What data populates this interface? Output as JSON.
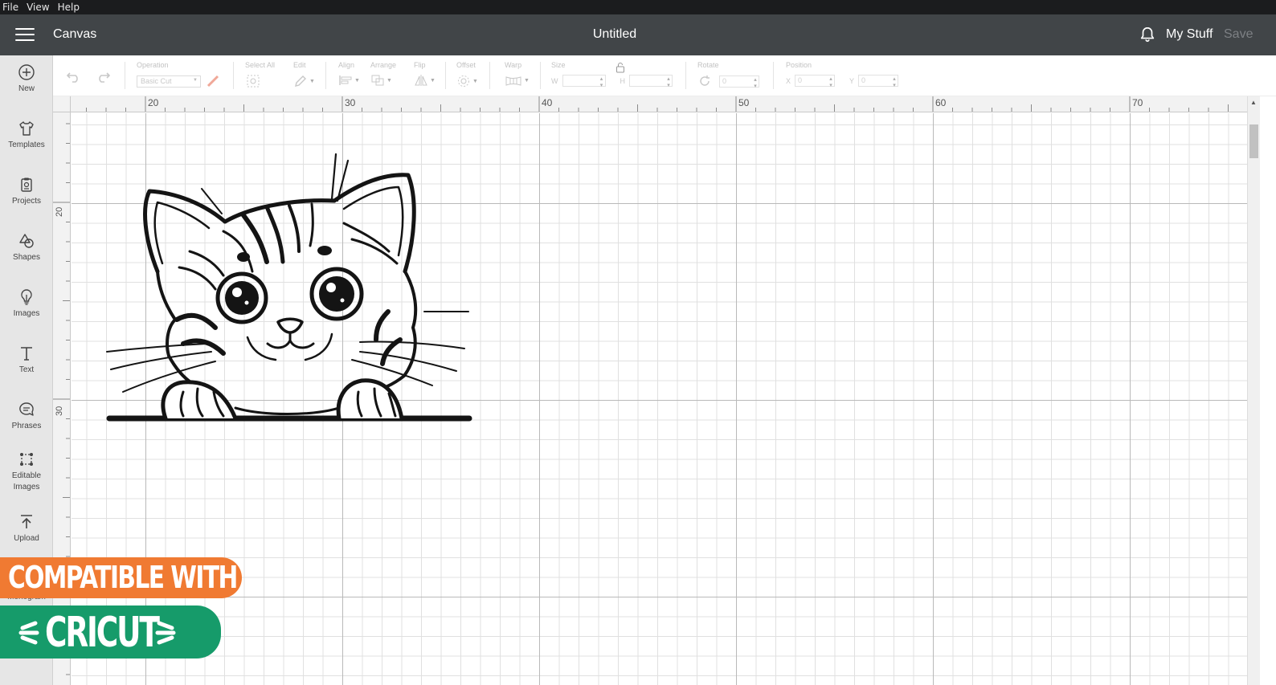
{
  "menubar": {
    "items": [
      "File",
      "View",
      "Help"
    ]
  },
  "header": {
    "app_title": "Canvas",
    "doc_title": "Untitled",
    "mystuff": "My Stuff",
    "save": "Save"
  },
  "sidebar": {
    "items": [
      {
        "label": "New",
        "icon": "plus-circle-icon"
      },
      {
        "label": "Templates",
        "icon": "shirt-icon"
      },
      {
        "label": "Projects",
        "icon": "clipboard-icon"
      },
      {
        "label": "Shapes",
        "icon": "shapes-icon"
      },
      {
        "label": "Images",
        "icon": "lightbulb-icon"
      },
      {
        "label": "Text",
        "icon": "text-icon"
      },
      {
        "label": "Phrases",
        "icon": "speech-bubble-icon"
      },
      {
        "label": "Editable Images",
        "icon": "editable-icon"
      },
      {
        "label": "Upload",
        "icon": "upload-icon"
      }
    ],
    "partial_label": "Monogram"
  },
  "toolbar": {
    "operation_label": "Operation",
    "operation_value": "Basic Cut",
    "select_all": "Select All",
    "edit": "Edit",
    "align": "Align",
    "arrange": "Arrange",
    "flip": "Flip",
    "offset": "Offset",
    "warp": "Warp",
    "size": "Size",
    "w": "W",
    "h": "H",
    "rotate": "Rotate",
    "rotate_value": "0",
    "position": "Position",
    "x": "X",
    "x_value": "0",
    "y": "Y",
    "y_value": "0"
  },
  "rulers": {
    "top": [
      "20",
      "30",
      "40",
      "50",
      "60",
      "70"
    ],
    "left": [
      "20",
      "30"
    ]
  },
  "badges": {
    "compatible": "COMPATIBLE WITH",
    "brand": "CRICUT"
  },
  "colors": {
    "header": "#414548",
    "badge_orange": "#f07a32",
    "badge_green": "#169b6a"
  }
}
